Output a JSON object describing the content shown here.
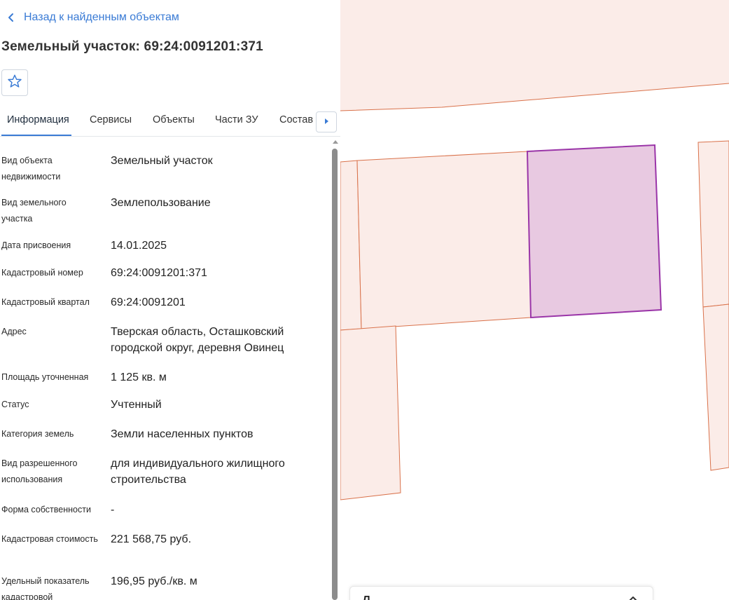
{
  "back_link": {
    "label": "Назад к найденным объектам"
  },
  "page_title": "Земельный участок: 69:24:0091201:371",
  "tabs": [
    {
      "label": "Информация"
    },
    {
      "label": "Сервисы"
    },
    {
      "label": "Объекты"
    },
    {
      "label": "Части ЗУ"
    },
    {
      "label": "Состав"
    }
  ],
  "info": [
    {
      "label": "Вид объекта недвижимости",
      "value": "Земельный участок"
    },
    {
      "label": "Вид земельного участка",
      "value": "Землепользование"
    },
    {
      "label": "Дата присвоения",
      "value": "14.01.2025"
    },
    {
      "label": "Кадастровый номер",
      "value": "69:24:0091201:371"
    },
    {
      "label": "Кадастровый квартал",
      "value": "69:24:0091201"
    },
    {
      "label": "Адрес",
      "value": "Тверская область, Осташковский городской округ, деревня Овинец"
    },
    {
      "label": "Площадь уточненная",
      "value": "1 125 кв. м"
    },
    {
      "label": "Статус",
      "value": "Учтенный"
    },
    {
      "label": "Категория земель",
      "value": "Земли населенных пунктов"
    },
    {
      "label": "Вид разрешенного использования",
      "value": "для индивидуального жилищного строительства"
    },
    {
      "label": "Форма собственности",
      "value": "-"
    },
    {
      "label": "Кадастровая стоимость",
      "value": "221 568,75 руб."
    },
    {
      "label": "Удельный показатель кадастровой",
      "value": "196,95 руб./кв. м"
    }
  ],
  "map_card": {
    "title": "Л"
  },
  "colors": {
    "accent": "#3a7bd5",
    "parcel_fill": "#fbece8",
    "parcel_stroke": "#d9714a",
    "selected_fill": "#e8c9e1",
    "selected_stroke": "#9a35a8"
  },
  "icons": {
    "back": "chevron-left-icon",
    "favorite": "star-outline-icon",
    "tabs_next": "caret-right-icon",
    "card_toggle": "chevron-up-icon"
  }
}
